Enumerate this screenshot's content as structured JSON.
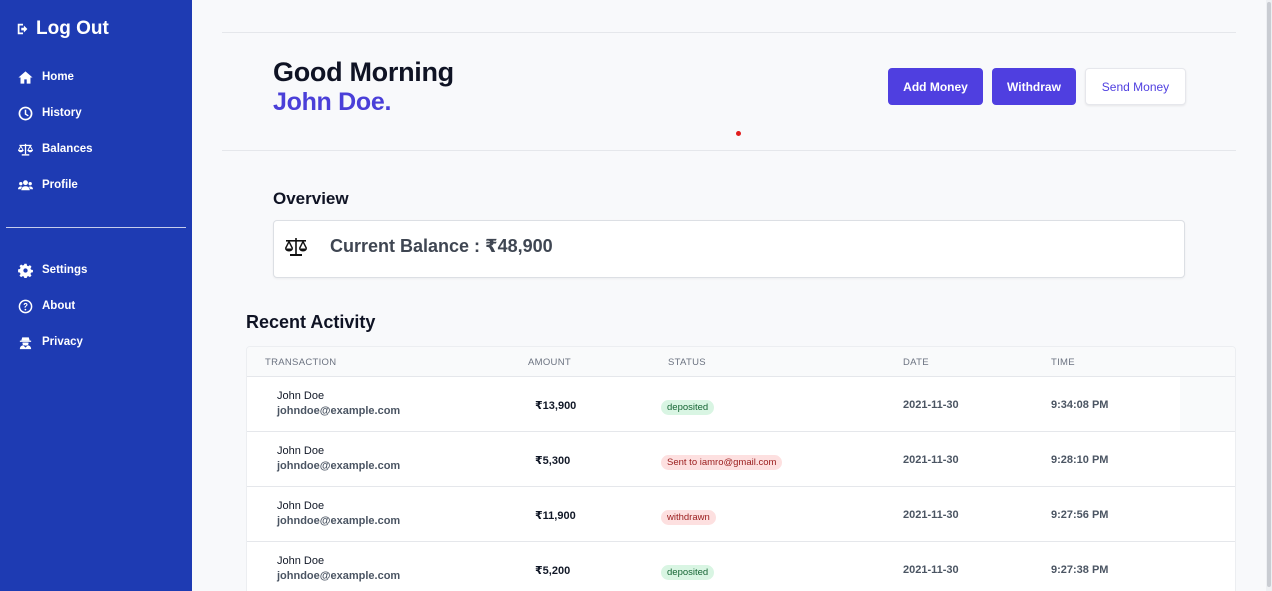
{
  "sidebar": {
    "logout_label": "Log Out",
    "nav_primary": [
      {
        "label": "Home",
        "icon": "home-icon"
      },
      {
        "label": "History",
        "icon": "clock-icon"
      },
      {
        "label": "Balances",
        "icon": "scale-icon"
      },
      {
        "label": "Profile",
        "icon": "users-icon"
      }
    ],
    "nav_secondary": [
      {
        "label": "Settings",
        "icon": "gear-icon"
      },
      {
        "label": "About",
        "icon": "question-icon"
      },
      {
        "label": "Privacy",
        "icon": "user-secret-icon"
      }
    ],
    "color": "#1e3bb3"
  },
  "header": {
    "greeting": "Good Morning",
    "user_name": "John Doe.",
    "buttons": {
      "add_money": "Add Money",
      "withdraw": "Withdraw",
      "send_money": "Send Money"
    },
    "accent": "#4f3fe0"
  },
  "overview": {
    "title": "Overview",
    "balance_text": "Current Balance : ₹48,900",
    "icon": "scale-icon"
  },
  "recent": {
    "title": "Recent Activity",
    "columns": [
      "TRANSACTION",
      "AMOUNT",
      "STATUS",
      "DATE",
      "TIME"
    ],
    "rows": [
      {
        "name": "John Doe",
        "email": "johndoe@example.com",
        "amount": "₹13,900",
        "status": "deposited",
        "status_color": "green",
        "date": "2021-11-30",
        "time": "9:34:08 PM"
      },
      {
        "name": "John Doe",
        "email": "johndoe@example.com",
        "amount": "₹5,300",
        "status": "Sent to iamro@gmail.com",
        "status_color": "red",
        "date": "2021-11-30",
        "time": "9:28:10 PM"
      },
      {
        "name": "John Doe",
        "email": "johndoe@example.com",
        "amount": "₹11,900",
        "status": "withdrawn",
        "status_color": "red",
        "date": "2021-11-30",
        "time": "9:27:56 PM"
      },
      {
        "name": "John Doe",
        "email": "johndoe@example.com",
        "amount": "₹5,200",
        "status": "deposited",
        "status_color": "green",
        "date": "2021-11-30",
        "time": "9:27:38 PM"
      }
    ]
  }
}
